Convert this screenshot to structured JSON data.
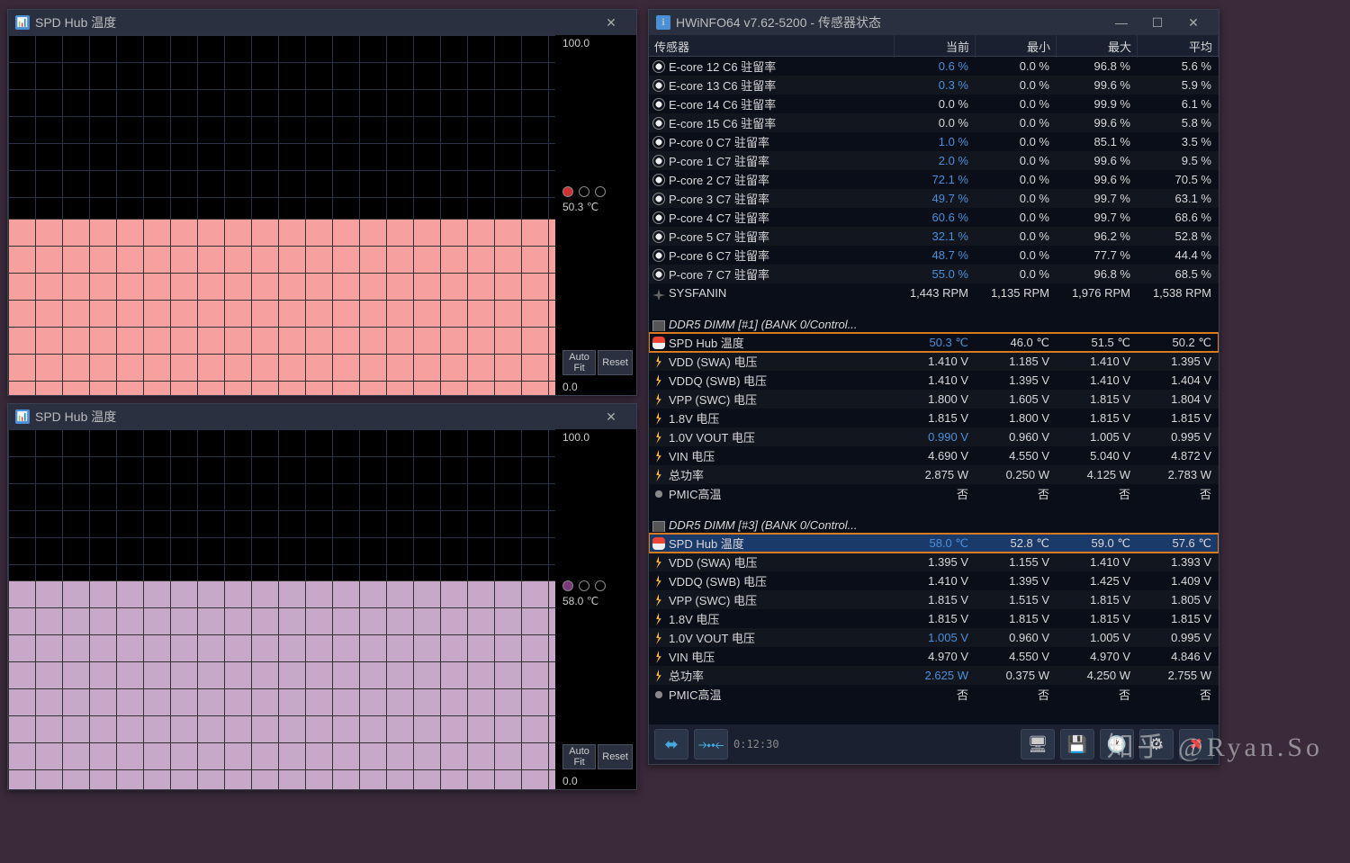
{
  "graph1": {
    "title": "SPD Hub 温度",
    "ymax": "100.0",
    "current": "50.3 ℃",
    "ymin": "0.0",
    "autofit": "Auto Fit",
    "reset": "Reset",
    "fillColor": "#f7a0a0",
    "fillHeight": "49%",
    "dotColor": "#d03030"
  },
  "graph2": {
    "title": "SPD Hub 温度",
    "ymax": "100.0",
    "current": "58.0 ℃",
    "ymin": "0.0",
    "autofit": "Auto Fit",
    "reset": "Reset",
    "fillColor": "#c8a8c8",
    "fillHeight": "58%",
    "dotColor": "#7a3a7a"
  },
  "hw": {
    "title": "HWiNFO64 v7.62-5200 - 传感器状态",
    "cols": {
      "sensor": "传感器",
      "cur": "当前",
      "min": "最小",
      "max": "最大",
      "avg": "平均"
    },
    "timer": "0:12:30",
    "rows": [
      {
        "t": "r",
        "ico": "clock",
        "lbl": "E-core 12 C6 驻留率",
        "c": "0.6 %",
        "mn": "0.0 %",
        "mx": "96.8 %",
        "av": "5.6 %",
        "cb": 1
      },
      {
        "t": "r",
        "ico": "clock",
        "lbl": "E-core 13 C6 驻留率",
        "c": "0.3 %",
        "mn": "0.0 %",
        "mx": "99.6 %",
        "av": "5.9 %",
        "cb": 1
      },
      {
        "t": "r",
        "ico": "clock",
        "lbl": "E-core 14 C6 驻留率",
        "c": "0.0 %",
        "mn": "0.0 %",
        "mx": "99.9 %",
        "av": "6.1 %"
      },
      {
        "t": "r",
        "ico": "clock",
        "lbl": "E-core 15 C6 驻留率",
        "c": "0.0 %",
        "mn": "0.0 %",
        "mx": "99.6 %",
        "av": "5.8 %"
      },
      {
        "t": "r",
        "ico": "clock",
        "lbl": "P-core 0 C7 驻留率",
        "c": "1.0 %",
        "mn": "0.0 %",
        "mx": "85.1 %",
        "av": "3.5 %",
        "cb": 1
      },
      {
        "t": "r",
        "ico": "clock",
        "lbl": "P-core 1 C7 驻留率",
        "c": "2.0 %",
        "mn": "0.0 %",
        "mx": "99.6 %",
        "av": "9.5 %",
        "cb": 1
      },
      {
        "t": "r",
        "ico": "clock",
        "lbl": "P-core 2 C7 驻留率",
        "c": "72.1 %",
        "mn": "0.0 %",
        "mx": "99.6 %",
        "av": "70.5 %",
        "cb": 1
      },
      {
        "t": "r",
        "ico": "clock",
        "lbl": "P-core 3 C7 驻留率",
        "c": "49.7 %",
        "mn": "0.0 %",
        "mx": "99.7 %",
        "av": "63.1 %",
        "cb": 1
      },
      {
        "t": "r",
        "ico": "clock",
        "lbl": "P-core 4 C7 驻留率",
        "c": "60.6 %",
        "mn": "0.0 %",
        "mx": "99.7 %",
        "av": "68.6 %",
        "cb": 1
      },
      {
        "t": "r",
        "ico": "clock",
        "lbl": "P-core 5 C7 驻留率",
        "c": "32.1 %",
        "mn": "0.0 %",
        "mx": "96.2 %",
        "av": "52.8 %",
        "cb": 1
      },
      {
        "t": "r",
        "ico": "clock",
        "lbl": "P-core 6 C7 驻留率",
        "c": "48.7 %",
        "mn": "0.0 %",
        "mx": "77.7 %",
        "av": "44.4 %",
        "cb": 1
      },
      {
        "t": "r",
        "ico": "clock",
        "lbl": "P-core 7 C7 驻留率",
        "c": "55.0 %",
        "mn": "0.0 %",
        "mx": "96.8 %",
        "av": "68.5 %",
        "cb": 1
      },
      {
        "t": "r",
        "ico": "fan",
        "lbl": "SYSFANIN",
        "c": "1,443 RPM",
        "mn": "1,135 RPM",
        "mx": "1,976 RPM",
        "av": "1,538 RPM"
      },
      {
        "t": "sp"
      },
      {
        "t": "g",
        "ico": "chip",
        "lbl": "DDR5 DIMM [#1] (BANK 0/Control..."
      },
      {
        "t": "r",
        "ico": "temp",
        "lbl": "SPD Hub 温度",
        "c": "50.3 ℃",
        "mn": "46.0 ℃",
        "mx": "51.5 ℃",
        "av": "50.2 ℃",
        "hl": 1,
        "cb": 1
      },
      {
        "t": "r",
        "ico": "volt",
        "lbl": "VDD (SWA) 电压",
        "c": "1.410 V",
        "mn": "1.185 V",
        "mx": "1.410 V",
        "av": "1.395 V"
      },
      {
        "t": "r",
        "ico": "volt",
        "lbl": "VDDQ (SWB) 电压",
        "c": "1.410 V",
        "mn": "1.395 V",
        "mx": "1.410 V",
        "av": "1.404 V"
      },
      {
        "t": "r",
        "ico": "volt",
        "lbl": "VPP (SWC) 电压",
        "c": "1.800 V",
        "mn": "1.605 V",
        "mx": "1.815 V",
        "av": "1.804 V"
      },
      {
        "t": "r",
        "ico": "volt",
        "lbl": "1.8V 电压",
        "c": "1.815 V",
        "mn": "1.800 V",
        "mx": "1.815 V",
        "av": "1.815 V"
      },
      {
        "t": "r",
        "ico": "volt",
        "lbl": "1.0V VOUT 电压",
        "c": "0.990 V",
        "mn": "0.960 V",
        "mx": "1.005 V",
        "av": "0.995 V",
        "cb": 1
      },
      {
        "t": "r",
        "ico": "volt",
        "lbl": "VIN 电压",
        "c": "4.690 V",
        "mn": "4.550 V",
        "mx": "5.040 V",
        "av": "4.872 V"
      },
      {
        "t": "r",
        "ico": "pwr",
        "lbl": "总功率",
        "c": "2.875 W",
        "mn": "0.250 W",
        "mx": "4.125 W",
        "av": "2.783 W"
      },
      {
        "t": "r",
        "ico": "dot",
        "lbl": "PMIC高温",
        "c": "否",
        "mn": "否",
        "mx": "否",
        "av": "否"
      },
      {
        "t": "sp"
      },
      {
        "t": "g",
        "ico": "chip",
        "lbl": "DDR5 DIMM [#3] (BANK 0/Control..."
      },
      {
        "t": "r",
        "ico": "temp",
        "lbl": "SPD Hub 温度",
        "c": "58.0 ℃",
        "mn": "52.8 ℃",
        "mx": "59.0 ℃",
        "av": "57.6 ℃",
        "hl": 1,
        "sel": 1,
        "cb": 1
      },
      {
        "t": "r",
        "ico": "volt",
        "lbl": "VDD (SWA) 电压",
        "c": "1.395 V",
        "mn": "1.155 V",
        "mx": "1.410 V",
        "av": "1.393 V"
      },
      {
        "t": "r",
        "ico": "volt",
        "lbl": "VDDQ (SWB) 电压",
        "c": "1.410 V",
        "mn": "1.395 V",
        "mx": "1.425 V",
        "av": "1.409 V"
      },
      {
        "t": "r",
        "ico": "volt",
        "lbl": "VPP (SWC) 电压",
        "c": "1.815 V",
        "mn": "1.515 V",
        "mx": "1.815 V",
        "av": "1.805 V"
      },
      {
        "t": "r",
        "ico": "volt",
        "lbl": "1.8V 电压",
        "c": "1.815 V",
        "mn": "1.815 V",
        "mx": "1.815 V",
        "av": "1.815 V"
      },
      {
        "t": "r",
        "ico": "volt",
        "lbl": "1.0V VOUT 电压",
        "c": "1.005 V",
        "mn": "0.960 V",
        "mx": "1.005 V",
        "av": "0.995 V",
        "cb": 1
      },
      {
        "t": "r",
        "ico": "volt",
        "lbl": "VIN 电压",
        "c": "4.970 V",
        "mn": "4.550 V",
        "mx": "4.970 V",
        "av": "4.846 V"
      },
      {
        "t": "r",
        "ico": "pwr",
        "lbl": "总功率",
        "c": "2.625 W",
        "mn": "0.375 W",
        "mx": "4.250 W",
        "av": "2.755 W",
        "cb": 1
      },
      {
        "t": "r",
        "ico": "dot",
        "lbl": "PMIC高温",
        "c": "否",
        "mn": "否",
        "mx": "否",
        "av": "否"
      }
    ]
  },
  "watermark": "知乎 @Ryan.So"
}
